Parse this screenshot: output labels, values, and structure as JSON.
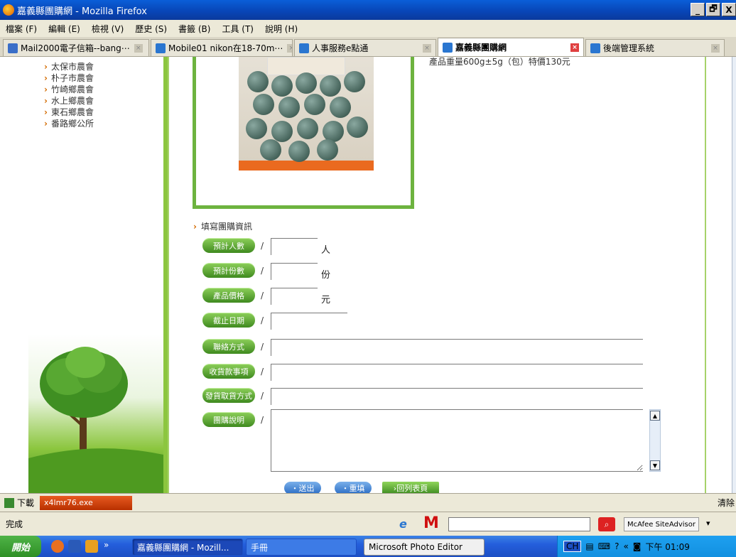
{
  "window": {
    "title": "嘉義縣團購網 - Mozilla Firefox",
    "controls": [
      "_",
      "🗗",
      "X"
    ]
  },
  "menu": [
    "檔案 (F)",
    "編輯 (E)",
    "檢視 (V)",
    "歷史 (S)",
    "書籤 (B)",
    "工具 (T)",
    "說明 (H)"
  ],
  "tabs": [
    {
      "label": "Mail2000電子信箱--bang⋯",
      "active": false
    },
    {
      "label": "Mobile01 nikon在18-70m⋯",
      "active": false
    },
    {
      "label": "人事服務e點通",
      "active": false
    },
    {
      "label": "嘉義縣團購網",
      "active": true
    },
    {
      "label": "後端管理系統",
      "active": false
    }
  ],
  "sidebar": {
    "items": [
      "太保市農會",
      "朴子市農會",
      "竹崎鄉農會",
      "水上鄉農會",
      "東石鄉農會",
      "番路鄉公所"
    ]
  },
  "product": {
    "desc": "產品重量600g±5g（包）特價130元"
  },
  "form": {
    "section_title": "填寫團購資訊",
    "fields": [
      {
        "label": "預計人數",
        "unit": "人",
        "value": ""
      },
      {
        "label": "預計份數",
        "unit": "份",
        "value": ""
      },
      {
        "label": "產品價格",
        "unit": "元",
        "value": ""
      },
      {
        "label": "截止日期",
        "unit": "",
        "value": ""
      },
      {
        "label": "聯絡方式",
        "unit": "",
        "value": ""
      },
      {
        "label": "收貨款事項",
        "unit": "",
        "value": ""
      },
      {
        "label": "發貨取貨方式",
        "unit": "",
        "value": ""
      },
      {
        "label": "團購說明",
        "unit": "",
        "value": ""
      }
    ],
    "buttons": {
      "submit": "・送出",
      "reset": "・重填",
      "back": "›回列表頁"
    }
  },
  "downloads": {
    "label": "下載",
    "item": "x4lmr76.exe",
    "clear": "清除"
  },
  "status": {
    "text": "完成",
    "mcafee": "McAfee SiteAdvisor"
  },
  "taskbar": {
    "start": "開始",
    "tasks": [
      "嘉義縣團購網 - Mozill...",
      "手冊",
      "Microsoft Photo Editor"
    ],
    "tray": {
      "lang": "CH",
      "time": "下午 01:09"
    }
  }
}
